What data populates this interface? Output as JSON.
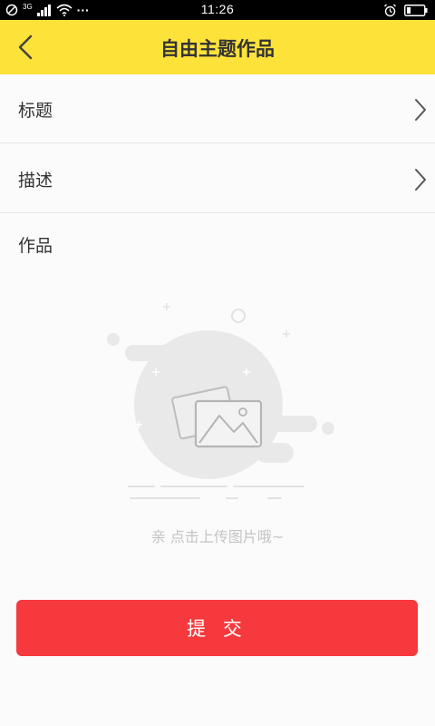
{
  "status_bar": {
    "network": "3G",
    "time": "11:26",
    "dots": "···"
  },
  "header": {
    "title": "自由主题作品"
  },
  "form": {
    "title_label": "标题",
    "description_label": "描述",
    "works_label": "作品"
  },
  "upload": {
    "hint": "亲 点击上传图片哦~"
  },
  "submit": {
    "label": "提 交"
  },
  "colors": {
    "header_bg": "#fde23a",
    "submit_bg": "#f5393d",
    "hint_text": "#c4c4c4"
  }
}
